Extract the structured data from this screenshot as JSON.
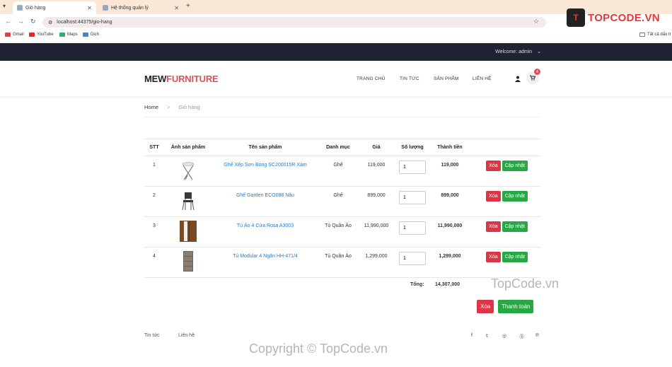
{
  "browser": {
    "tabs": [
      {
        "title": "Giỏ hàng",
        "active": true
      },
      {
        "title": "Hệ thống quản lý",
        "active": false
      }
    ],
    "url": "localhost:44375/gio-hang",
    "bookmarks": [
      "Gmail",
      "YouTube",
      "Maps",
      "Dịch"
    ],
    "all_bookmarks": "Tất cả dấu tr"
  },
  "topbar": {
    "welcome": "Welcome: admin"
  },
  "header": {
    "logo_part1": "MEW",
    "logo_part2": "FURNITURE",
    "menu": [
      "TRANG CHỦ",
      "TIN TỨC",
      "SẢN PHẨM",
      "LIÊN HỆ"
    ],
    "cart_count": "4"
  },
  "breadcrumb": {
    "home": "Home",
    "sep": ">",
    "current": "Giỏ hàng"
  },
  "table": {
    "headers": [
      "STT",
      "Ảnh sản phẩm",
      "Tên sản phẩm",
      "Danh mục",
      "Giá",
      "Số lượng",
      "Thành tiền",
      ""
    ],
    "rows": [
      {
        "stt": "1",
        "name": "Ghế Xếp Sơn Bóng SC200015R Xám",
        "category": "Ghế",
        "price": "119,000",
        "qty": "1",
        "total": "119,000",
        "img": "folding-chair"
      },
      {
        "stt": "2",
        "name": "Ghế Garden ECO088 Nâu",
        "category": "Ghế",
        "price": "899,000",
        "qty": "1",
        "total": "899,000",
        "img": "garden-chair"
      },
      {
        "stt": "3",
        "name": "Tủ Áo 4 Cửa Rosa A3003",
        "category": "Tủ Quần Áo",
        "price": "11,990,000",
        "qty": "1",
        "total": "11,990,000",
        "img": "wardrobe"
      },
      {
        "stt": "4",
        "name": "Tủ Modular 4 Ngăn HH-471/4",
        "category": "Tủ Quần Áo",
        "price": "1,299,000",
        "qty": "1",
        "total": "1,299,000",
        "img": "drawer-cabinet"
      }
    ],
    "delete_label": "Xóa",
    "update_label": "Cập nhật",
    "total_label": "Tổng:",
    "total_value": "14,307,000"
  },
  "actions": {
    "clear": "Xóa",
    "checkout": "Thanh toán"
  },
  "footer": {
    "links": [
      "Tin tức",
      "Liên hệ"
    ],
    "social_icons": [
      "facebook-icon",
      "twitter-icon",
      "instagram-icon",
      "skype-icon",
      "pinterest-icon"
    ]
  },
  "watermarks": {
    "brand": "TOPCODE.VN",
    "site": "TopCode.vn",
    "copyright": "Copyright © TopCode.vn"
  },
  "colors": {
    "accent": "#e0505a",
    "danger": "#dc3545",
    "success": "#28a745",
    "link": "#2a7ac0",
    "topbar": "#1f2233"
  }
}
